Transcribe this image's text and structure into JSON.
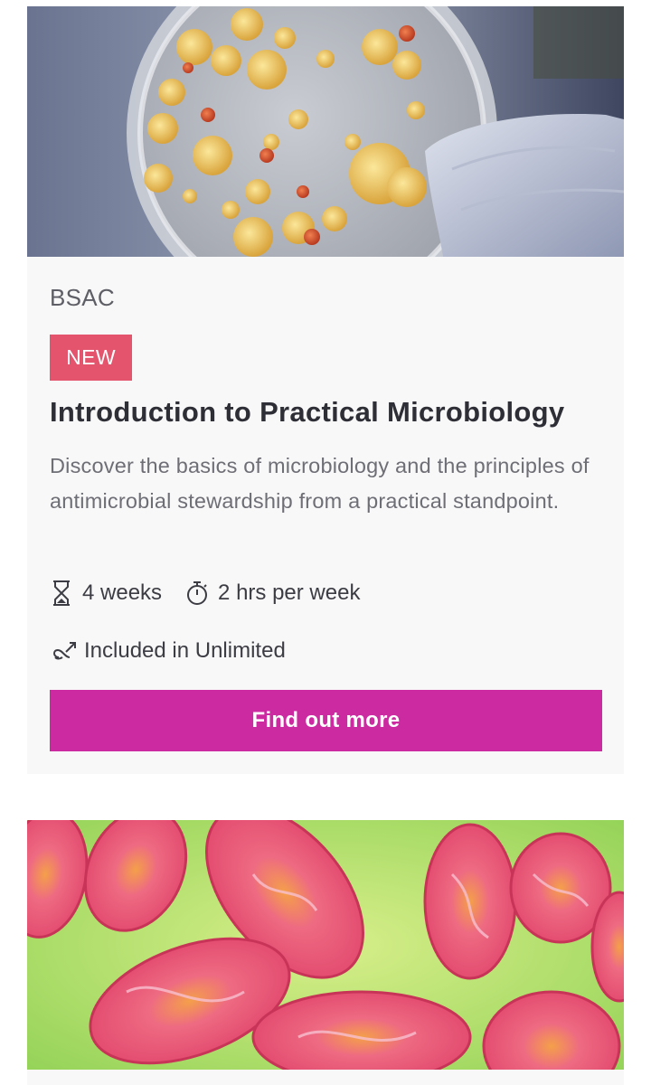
{
  "courses": [
    {
      "image_subject": "petri dish bacterial colonies",
      "provider": "BSAC",
      "badge": "NEW",
      "title": "Introduction to Practical Microbiology",
      "description": "Discover the basics of microbiology and the principles of antimicrobial stewardship from a practical standpoint.",
      "duration": "4 weeks",
      "duration_icon": "hourglass-icon",
      "effort": "2 hrs per week",
      "effort_icon": "stopwatch-icon",
      "unlimited": "Included in Unlimited",
      "unlimited_icon": "unlimited-icon",
      "cta_label": "Find out more"
    },
    {
      "image_subject": "mitochondria illustration"
    }
  ],
  "colors": {
    "card_background": "#f8f8f8",
    "badge": "#e4546d",
    "cta": "#cc2aa0",
    "title_text": "#2e2e36",
    "body_text": "#6e6e76"
  }
}
